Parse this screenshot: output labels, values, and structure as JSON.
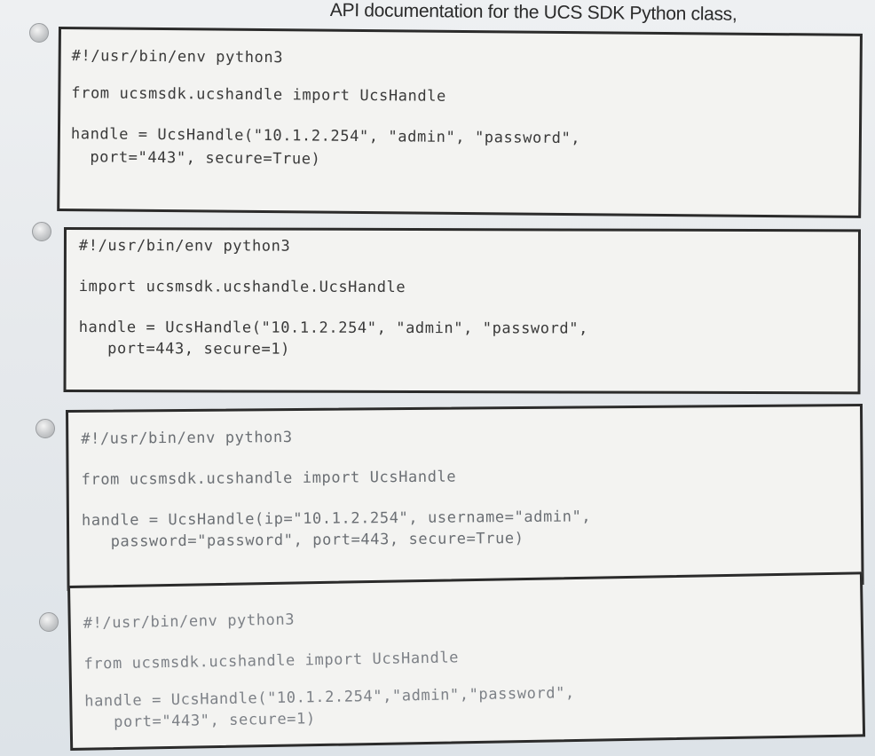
{
  "header": {
    "text": "API documentation for the UCS SDK Python class,"
  },
  "options": [
    {
      "shebang": "#!/usr/bin/env python3",
      "import_line": "from ucsmsdk.ucshandle import UcsHandle",
      "handle_line1": "handle = UcsHandle(\"10.1.2.254\", \"admin\", \"password\",",
      "handle_line2": "  port=\"443\", secure=True)"
    },
    {
      "shebang": "#!/usr/bin/env python3",
      "import_line": "import ucsmsdk.ucshandle.UcsHandle",
      "handle_line1": "handle = UcsHandle(\"10.1.2.254\", \"admin\", \"password\",",
      "handle_line2": "   port=443, secure=1)"
    },
    {
      "shebang": "#!/usr/bin/env python3",
      "import_line": "from ucsmsdk.ucshandle import UcsHandle",
      "handle_line1": "handle = UcsHandle(ip=\"10.1.2.254\", username=\"admin\",",
      "handle_line2": "   password=\"password\", port=443, secure=True)"
    },
    {
      "shebang": "#!/usr/bin/env python3",
      "import_line": "from ucsmsdk.ucshandle import UcsHandle",
      "handle_line1": "handle = UcsHandle(\"10.1.2.254\",\"admin\",\"password\",",
      "handle_line2": "   port=\"443\", secure=1)"
    }
  ]
}
